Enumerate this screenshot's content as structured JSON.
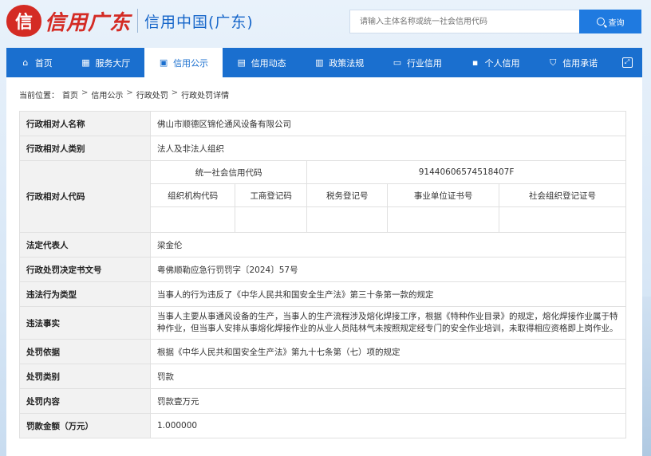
{
  "header": {
    "logo_char": "信",
    "logo_script": "信用广东",
    "site_name": "信用中国(广东)",
    "search_placeholder": "请输入主体名称或统一社会信用代码",
    "search_button": "查询"
  },
  "nav": [
    {
      "label": "首页",
      "icon": "home-icon"
    },
    {
      "label": "服务大厅",
      "icon": "grid-icon"
    },
    {
      "label": "信用公示",
      "icon": "inbox-icon"
    },
    {
      "label": "信用动态",
      "icon": "document-icon"
    },
    {
      "label": "政策法规",
      "icon": "book-icon"
    },
    {
      "label": "行业信用",
      "icon": "monitor-icon"
    },
    {
      "label": "个人信用",
      "icon": "id-card-icon"
    },
    {
      "label": "信用承诺",
      "icon": "shield-icon"
    }
  ],
  "nav_active_index": 2,
  "breadcrumb": {
    "prefix": "当前位置：",
    "items": [
      "首页",
      "信用公示",
      "行政处罚",
      "行政处罚详情"
    ],
    "separator": ">"
  },
  "detail": {
    "party_name_label": "行政相对人名称",
    "party_name": "佛山市顺德区锦伦通风设备有限公司",
    "party_type_label": "行政相对人类别",
    "party_type": "法人及非法人组织",
    "party_code_label": "行政相对人代码",
    "uscc_label": "统一社会信用代码",
    "uscc_value": "91440606574518407F",
    "code_headers": [
      "组织机构代码",
      "工商登记码",
      "税务登记号",
      "事业单位证书号",
      "社会组织登记证号"
    ],
    "code_values": [
      "",
      "",
      "",
      "",
      ""
    ],
    "legal_rep_label": "法定代表人",
    "legal_rep": "梁金伦",
    "doc_no_label": "行政处罚决定书文号",
    "doc_no": "粤佛顺勒应急行罚罚字〔2024〕57号",
    "violation_type_label": "违法行为类型",
    "violation_type": "当事人的行为违反了《中华人民共和国安全生产法》第三十条第一款的规定",
    "violation_facts_label": "违法事实",
    "violation_facts": "当事人主要从事通风设备的生产，当事人的生产流程涉及熔化焊接工序，根据《特种作业目录》的规定，熔化焊接作业属于特种作业，但当事人安排从事熔化焊接作业的从业人员陆林气未按照规定经专门的安全作业培训，未取得相应资格即上岗作业。",
    "basis_label": "处罚依据",
    "basis": "根据《中华人民共和国安全生产法》第九十七条第（七）项的规定",
    "penalty_type_label": "处罚类别",
    "penalty_type": "罚款",
    "penalty_content_label": "处罚内容",
    "penalty_content": "罚款壹万元",
    "amount_label": "罚款金额（万元）",
    "amount": "1.000000"
  },
  "colors": {
    "primary": "#1a6fcf",
    "brand_red": "#d42b24",
    "label_bg": "#f2f2f2"
  }
}
